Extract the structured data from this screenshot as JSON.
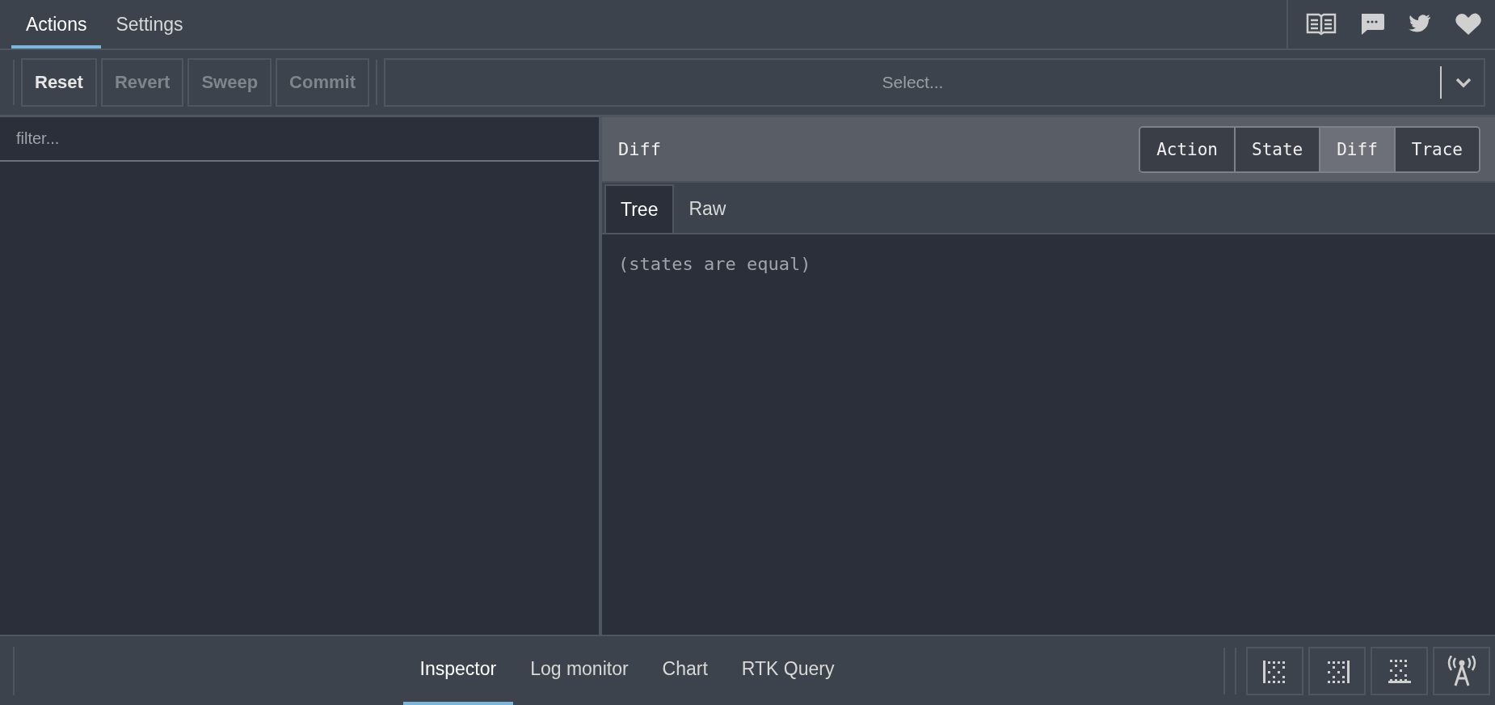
{
  "top_tabs": [
    {
      "label": "Actions",
      "selected": true
    },
    {
      "label": "Settings",
      "selected": false
    }
  ],
  "top_icons": [
    {
      "kind": "book"
    },
    {
      "kind": "chat"
    },
    {
      "kind": "bird"
    },
    {
      "kind": "heart"
    }
  ],
  "toolbar_buttons": [
    {
      "label": "Reset",
      "disabled": false
    },
    {
      "label": "Revert",
      "disabled": true
    },
    {
      "label": "Sweep",
      "disabled": true
    },
    {
      "label": "Commit",
      "disabled": true
    }
  ],
  "select": {
    "placeholder": "Select..."
  },
  "filter": {
    "placeholder": "filter..."
  },
  "panel": {
    "title": "Diff",
    "tabs": [
      {
        "label": "Action",
        "selected": false
      },
      {
        "label": "State",
        "selected": false
      },
      {
        "label": "Diff",
        "selected": true
      },
      {
        "label": "Trace",
        "selected": false
      }
    ],
    "subtabs": [
      {
        "label": "Tree",
        "selected": true
      },
      {
        "label": "Raw",
        "selected": false
      }
    ],
    "message": "(states are equal)"
  },
  "bottom_tabs": [
    {
      "label": "Inspector",
      "selected": true
    },
    {
      "label": "Log monitor",
      "selected": false
    },
    {
      "label": "Chart",
      "selected": false
    },
    {
      "label": "RTK Query",
      "selected": false
    }
  ],
  "bottom_icons": [
    {
      "kind": "dock-left"
    },
    {
      "kind": "dock-right"
    },
    {
      "kind": "dock-bottom"
    },
    {
      "kind": "remote"
    }
  ]
}
